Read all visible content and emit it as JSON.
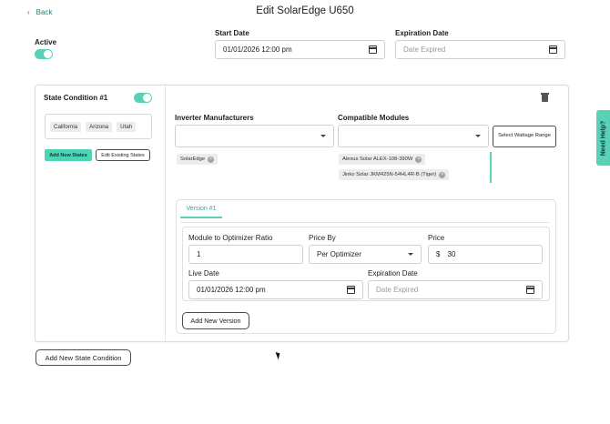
{
  "header": {
    "back_label": "Back",
    "title": "Edit SolarEdge U650"
  },
  "active": {
    "label": "Active",
    "enabled": true
  },
  "dates": {
    "start_label": "Start Date",
    "start_value": "01/01/2026 12:00 pm",
    "expiration_label": "Expiration Date",
    "expiration_placeholder": "Date Expired"
  },
  "state_condition": {
    "title": "State Condition #1",
    "enabled": true,
    "states": [
      "California",
      "Arizona",
      "Utah"
    ],
    "add_states_label": "Add New States",
    "edit_states_label": "Edit Existing States"
  },
  "manufacturers": {
    "label": "Inverter Manufacturers",
    "tags": [
      "SolarEdge"
    ]
  },
  "modules": {
    "label": "Compatible Modules",
    "wattage_button": "Select Wattage Range",
    "tags": [
      "Alexus Solar ALEX-108-390W",
      "Jinko Solar JKM425N-54HL4R-B (Tiger)"
    ]
  },
  "version": {
    "tab_label": "Version #1",
    "ratio_label": "Module to Optimizer Ratio",
    "ratio_value": "1",
    "price_by_label": "Price By",
    "price_by_value": "Per Optimizer",
    "price_label": "Price",
    "price_currency": "$",
    "price_value": "30",
    "live_date_label": "Live Date",
    "live_date_value": "01/01/2026 12:00 pm",
    "exp_label": "Expiration Date",
    "exp_placeholder": "Date Expired",
    "add_version_label": "Add New Version"
  },
  "add_state_condition_label": "Add New State Condition",
  "help_label": "Need Help?",
  "colors": {
    "accent": "#59d1b7",
    "accent_dark": "#2a7a6e"
  }
}
